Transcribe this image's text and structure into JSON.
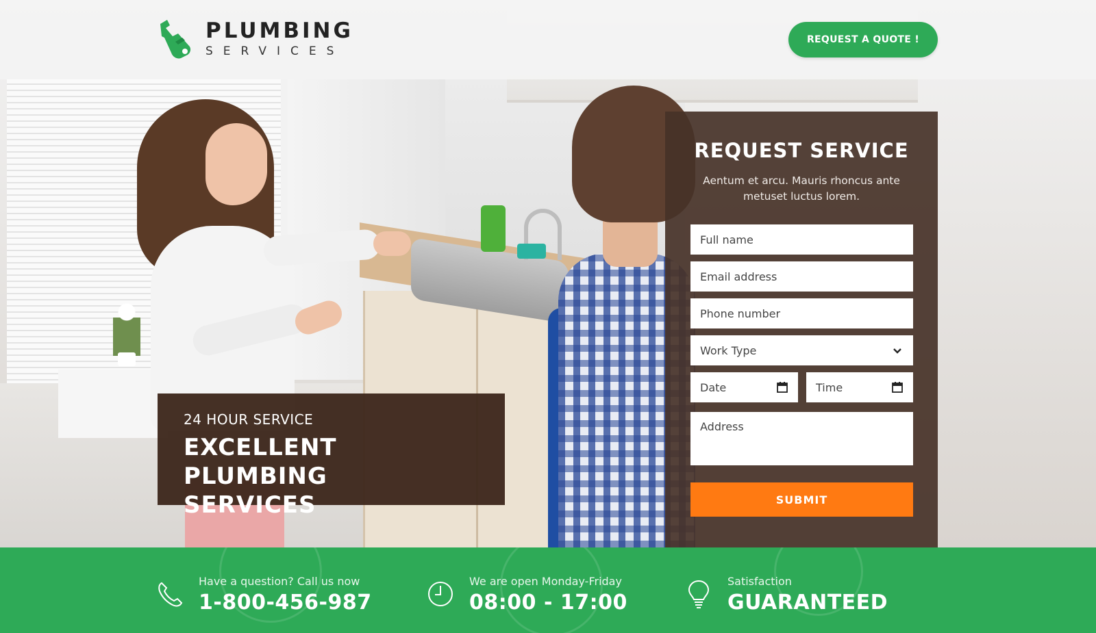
{
  "colors": {
    "brand_green": "#2eaa57",
    "form_panel": "#463228",
    "submit_orange": "#ff7a12",
    "caption_brown": "#3d281c"
  },
  "header": {
    "logo": {
      "title": "PLUMBING",
      "subtitle": "SERVICES",
      "icon": "wrench-hand-icon"
    },
    "cta_label": "REQUEST A QUOTE !"
  },
  "hero": {
    "caption": {
      "kicker": "24 HOUR SERVICE",
      "headline_line1": "EXCELLENT PLUMBING",
      "headline_line2": "SERVICES"
    }
  },
  "form": {
    "title": "REQUEST SERVICE",
    "description": "Aentum et arcu. Mauris rhoncus ante metuset luctus lorem.",
    "fields": {
      "full_name": "Full name",
      "email": "Email address",
      "phone": "Phone number",
      "work_type": "Work Type",
      "date": "Date",
      "time": "Time",
      "address": "Address"
    },
    "submit_label": "SUBMIT"
  },
  "footer": {
    "items": [
      {
        "icon": "phone-icon",
        "label": "Have a question? Call us now",
        "value": "1-800-456-987"
      },
      {
        "icon": "clock-icon",
        "label": "We are open Monday-Friday",
        "value": "08:00 - 17:00"
      },
      {
        "icon": "lightbulb-icon",
        "label": "Satisfaction",
        "value": "GUARANTEED"
      }
    ]
  }
}
